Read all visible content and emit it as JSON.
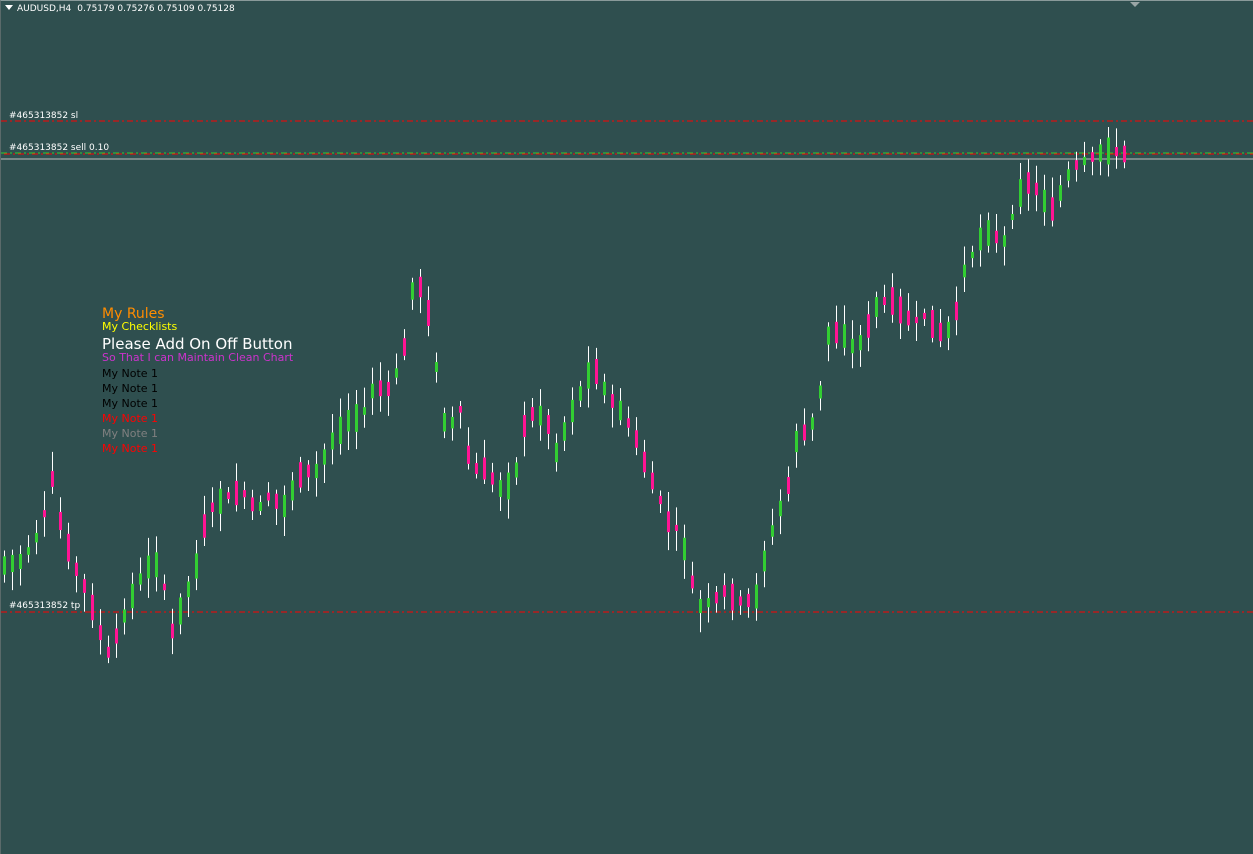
{
  "chart": {
    "symbol_header": "AUDUSD,H4",
    "ohlc": "0.75179 0.75276 0.75109 0.75128",
    "colors": {
      "background": "#2f4f4f",
      "bull": "#32cd32",
      "bear": "#ff1493",
      "wick": "#ffffff",
      "order_line": "#ff0000",
      "entry_line": "#32cd32",
      "bid_line": "#c0c0c0"
    }
  },
  "orders": {
    "sl_label": "#465313852 sl",
    "entry_label": "#465313852 sell 0.10",
    "tp_label": "#465313852 tp"
  },
  "notes": {
    "title": "My Rules",
    "subtitle": "My Checklists",
    "headline": "Please Add On Off Button",
    "subheadline": "So That I can Maintain Clean Chart",
    "items": [
      {
        "text": "My Note 1",
        "color": "#000000"
      },
      {
        "text": "My Note 1",
        "color": "#000000"
      },
      {
        "text": "My Note 1",
        "color": "#000000"
      },
      {
        "text": "My Note 1",
        "color": "#ff0000"
      },
      {
        "text": "My Note 1",
        "color": "#808080"
      },
      {
        "text": "My Note 1",
        "color": "#ff0000"
      }
    ]
  },
  "icons": {
    "menu": "dropdown-triangle-icon",
    "shift": "chart-shift-marker-icon"
  }
}
